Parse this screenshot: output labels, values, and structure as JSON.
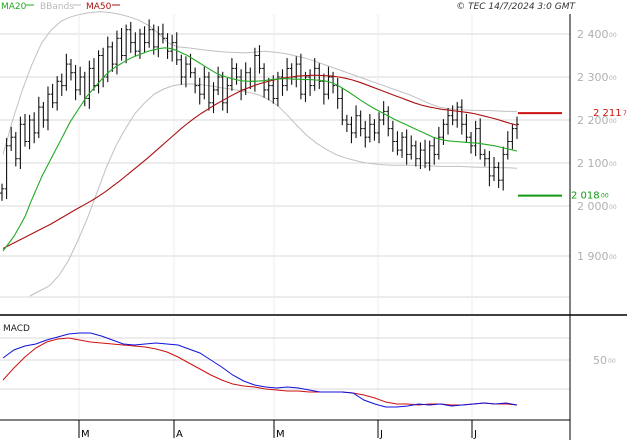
{
  "header": {
    "legend": [
      {
        "label": "MA20",
        "color": "#22aa22"
      },
      {
        "label": "BBands",
        "color": "#b8b8b8"
      },
      {
        "label": "MA50",
        "color": "#aa1111"
      }
    ],
    "copyright": "© TEC 14/7/2024 3:0 GMT"
  },
  "colors": {
    "price": "#111111",
    "ma20": "#22aa22",
    "ma50": "#aa1111",
    "bbands": "#c0c0c0",
    "grid": "#d8d8d8",
    "axis_text": "#b0b0b0",
    "macd": "#1111dd",
    "signal": "#cc1111",
    "resistance": "#cc1111",
    "support": "#119911"
  },
  "chart_data": [
    {
      "type": "ohlc",
      "x": [
        "M",
        "A",
        "M",
        "J",
        "J"
      ],
      "y_ticks": [
        "2 400",
        "2 300",
        "2 200",
        "2 100",
        "2 000",
        "1 900"
      ],
      "y_ticks_small": [
        "00",
        "00",
        "00",
        "00",
        "00",
        "00"
      ],
      "ylim": [
        1820,
        2460
      ],
      "grid": true,
      "close": [
        2040,
        2140,
        2160,
        2110,
        2190,
        2150,
        2200,
        2170,
        2230,
        2200,
        2260,
        2240,
        2290,
        2280,
        2330,
        2310,
        2270,
        2300,
        2250,
        2320,
        2280,
        2350,
        2300,
        2370,
        2330,
        2390,
        2350,
        2410,
        2380,
        2360,
        2400,
        2380,
        2410,
        2370,
        2400,
        2390,
        2360,
        2380,
        2340,
        2300,
        2330,
        2310,
        2280,
        2260,
        2300,
        2240,
        2270,
        2300,
        2240,
        2280,
        2320,
        2300,
        2270,
        2310,
        2290,
        2350,
        2320,
        2270,
        2280,
        2250,
        2300,
        2280,
        2320,
        2300,
        2330,
        2260,
        2300,
        2280,
        2320,
        2290,
        2260,
        2300,
        2280,
        2250,
        2200,
        2190,
        2170,
        2210,
        2180,
        2160,
        2190,
        2170,
        2200,
        2220,
        2180,
        2150,
        2130,
        2160,
        2120,
        2140,
        2110,
        2130,
        2100,
        2140,
        2120,
        2160,
        2190,
        2210,
        2200,
        2230,
        2190,
        2160,
        2140,
        2180,
        2120,
        2110,
        2070,
        2090,
        2060,
        2120,
        2150,
        2180,
        2190
      ],
      "ma20": [
        1910,
        1925,
        1940,
        1960,
        1980,
        2010,
        2040,
        2070,
        2095,
        2120,
        2145,
        2170,
        2195,
        2215,
        2235,
        2255,
        2270,
        2285,
        2300,
        2312,
        2322,
        2330,
        2338,
        2345,
        2350,
        2355,
        2360,
        2363,
        2366,
        2368,
        2366,
        2362,
        2356,
        2350,
        2342,
        2334,
        2326,
        2318,
        2310,
        2304,
        2300,
        2296,
        2293,
        2291,
        2290,
        2290,
        2291,
        2292,
        2294,
        2295,
        2296,
        2296,
        2295,
        2295,
        2294,
        2294,
        2293,
        2292,
        2290,
        2286,
        2280,
        2272,
        2264,
        2255,
        2246,
        2238,
        2230,
        2223,
        2216,
        2209,
        2202,
        2196,
        2190,
        2184,
        2178,
        2172,
        2166,
        2160,
        2156,
        2153,
        2151,
        2150,
        2149,
        2148,
        2147,
        2146,
        2144,
        2142,
        2140,
        2137,
        2134,
        2131,
        2128
      ],
      "ma50": [
        1915,
        1922,
        1929,
        1936,
        1943,
        1950,
        1957,
        1964,
        1972,
        1980,
        1988,
        1996,
        2004,
        2013,
        2023,
        2034,
        2046,
        2058,
        2071,
        2084,
        2097,
        2110,
        2124,
        2138,
        2152,
        2166,
        2180,
        2193,
        2205,
        2216,
        2226,
        2236,
        2245,
        2254,
        2262,
        2270,
        2276,
        2282,
        2287,
        2291,
        2295,
        2298,
        2300,
        2302,
        2303,
        2304,
        2304,
        2303,
        2302,
        2300,
        2297,
        2293,
        2288,
        2282,
        2276,
        2270,
        2264,
        2258,
        2252,
        2246,
        2240,
        2235,
        2231,
        2228,
        2225,
        2223,
        2221,
        2219,
        2217,
        2214,
        2210,
        2206,
        2202,
        2197,
        2192,
        2188
      ],
      "bb_upper": [
        2120,
        2200,
        2270,
        2330,
        2380,
        2410,
        2430,
        2440,
        2446,
        2450,
        2452,
        2450,
        2446,
        2440,
        2432,
        2420,
        2402,
        2380,
        2370,
        2368,
        2365,
        2362,
        2360,
        2358,
        2357,
        2356,
        2358,
        2360,
        2358,
        2355,
        2350,
        2345,
        2338,
        2330,
        2322,
        2314,
        2306,
        2298,
        2290,
        2282,
        2274,
        2266,
        2258,
        2248,
        2238,
        2230,
        2226,
        2224,
        2223,
        2222,
        2222,
        2221,
        2220,
        2220
      ],
      "bb_lower": [
        1820,
        1830,
        1840,
        1860,
        1890,
        1930,
        1975,
        2030,
        2090,
        2140,
        2180,
        2215,
        2240,
        2260,
        2272,
        2280,
        2283,
        2284,
        2282,
        2279,
        2275,
        2272,
        2268,
        2264,
        2258,
        2248,
        2232,
        2210,
        2186,
        2164,
        2146,
        2132,
        2120,
        2112,
        2106,
        2101,
        2098,
        2096,
        2095,
        2095,
        2095,
        2094,
        2093,
        2092,
        2092,
        2092,
        2091,
        2090,
        2090,
        2089,
        2089,
        2088
      ],
      "annotations": [
        {
          "label": "2 211",
          "small": "7",
          "value": 2216,
          "color": "#cc1111"
        },
        {
          "label": "2 018",
          "small": "00",
          "value": 2024,
          "color": "#119911"
        }
      ]
    },
    {
      "type": "line",
      "title": "MACD",
      "y_ticks": [
        "50"
      ],
      "y_ticks_small": [
        "00"
      ],
      "ylim": [
        -20,
        80
      ],
      "series": [
        {
          "values": [
            52,
            60,
            64,
            66,
            70,
            73,
            76,
            77,
            77,
            74,
            70,
            66,
            65,
            66,
            67,
            66,
            65,
            61,
            57,
            50,
            43,
            35,
            29,
            25,
            23,
            22,
            23,
            22,
            20,
            18,
            18,
            18,
            17,
            10,
            6,
            3,
            3,
            4,
            6,
            5,
            6,
            4,
            5,
            6,
            7,
            6,
            7,
            5
          ]
        },
        {
          "values": [
            30,
            42,
            53,
            62,
            68,
            71,
            72,
            70,
            68,
            67,
            66,
            65,
            64,
            63,
            61,
            58,
            53,
            47,
            41,
            35,
            30,
            26,
            24,
            23,
            21,
            20,
            19,
            19,
            18,
            18,
            18,
            18,
            17,
            15,
            12,
            8,
            6,
            6,
            5,
            6,
            6,
            5,
            5,
            6,
            7,
            6,
            6,
            5
          ]
        }
      ]
    }
  ]
}
